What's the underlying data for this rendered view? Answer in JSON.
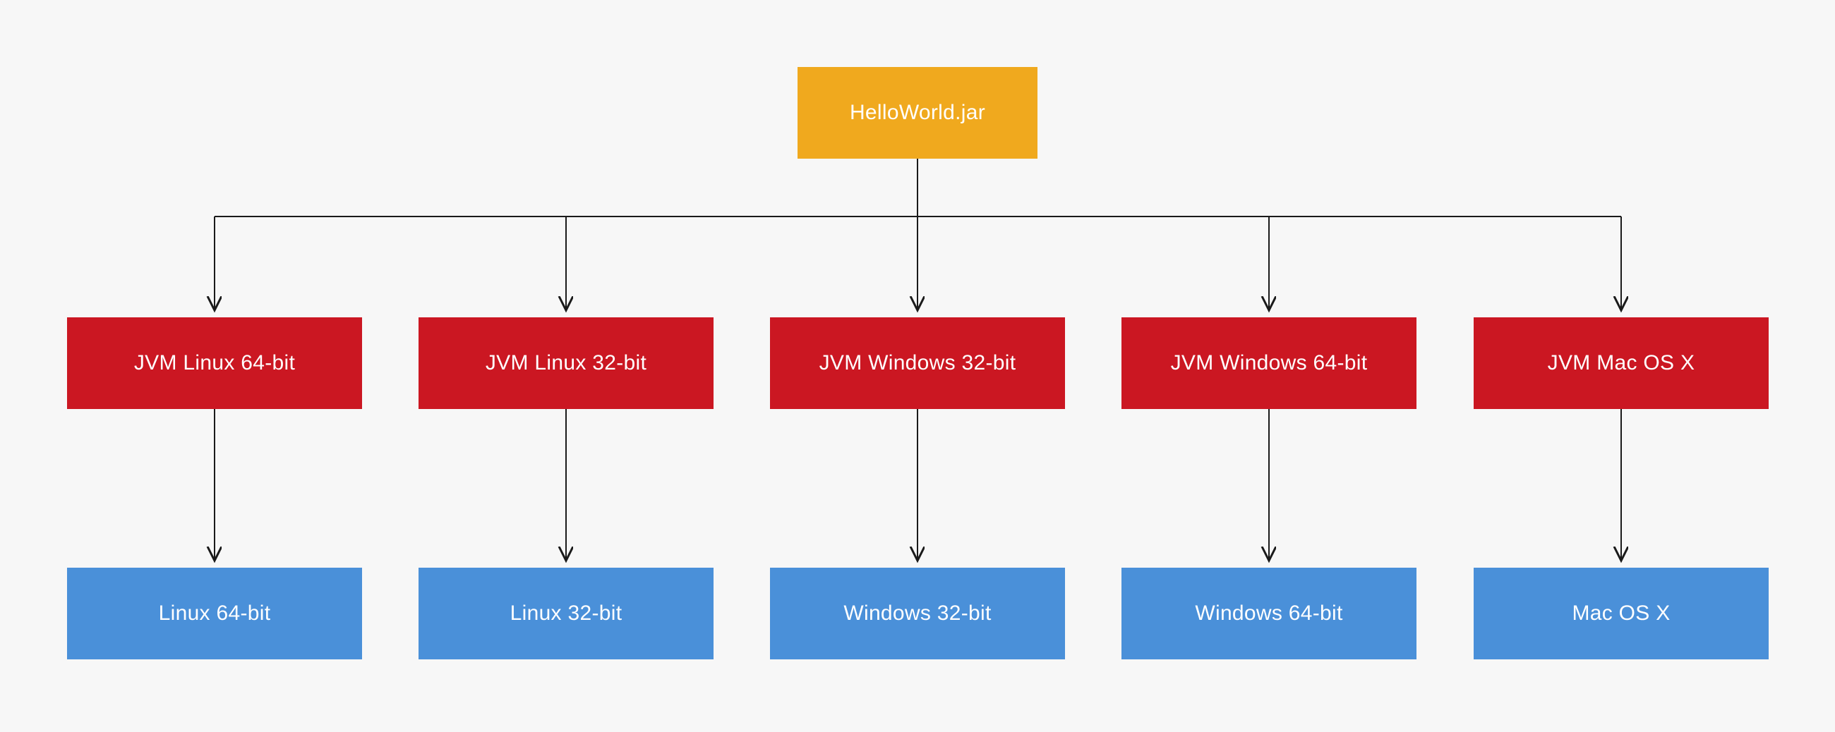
{
  "root": {
    "label": "HelloWorld.jar"
  },
  "jvm": [
    {
      "label": "JVM Linux 64-bit"
    },
    {
      "label": "JVM Linux 32-bit"
    },
    {
      "label": "JVM Windows 32-bit"
    },
    {
      "label": "JVM Windows 64-bit"
    },
    {
      "label": "JVM Mac OS X"
    }
  ],
  "os": [
    {
      "label": "Linux 64-bit"
    },
    {
      "label": "Linux 32-bit"
    },
    {
      "label": "Windows 32-bit"
    },
    {
      "label": "Windows 64-bit"
    },
    {
      "label": "Mac OS X"
    }
  ],
  "colors": {
    "root": "#f0a91e",
    "jvm": "#cb1722",
    "os": "#4a90d9",
    "bg": "#f7f7f7",
    "arrow": "#1a1a1a"
  }
}
